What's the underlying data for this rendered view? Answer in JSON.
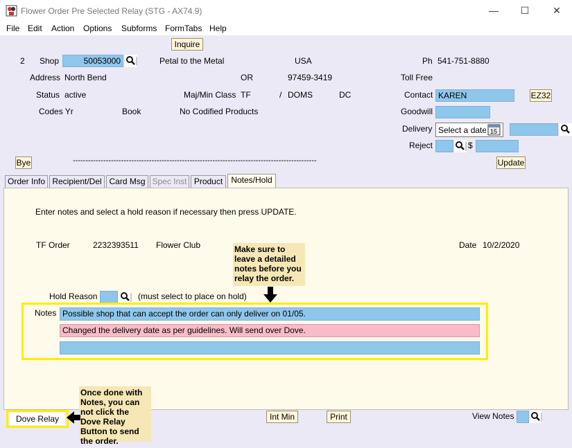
{
  "window": {
    "title": "Flower Order Pre Selected Relay (STG - AX74.9)",
    "minimize": "—",
    "maximize": "☐",
    "close": "✕"
  },
  "menu": [
    "File",
    "Edit",
    "Action",
    "Options",
    "Subforms",
    "FormTabs",
    "Help"
  ],
  "header": {
    "inquire": "Inquire",
    "row_num": "2",
    "shop_label": "Shop",
    "shop_value": "50053000",
    "shop_name": "Petal to the Metal",
    "country": "USA",
    "ph_label": "Ph",
    "phone": "541-751-8880",
    "address_label": "Address",
    "address": "North Bend",
    "state": "OR",
    "zip": "97459-3419",
    "tollfree_label": "Toll Free",
    "status_label": "Status",
    "status": "active",
    "majmin_label": "Maj/Min Class",
    "maj": "TF",
    "slash": "/",
    "min": "DOMS",
    "dc": "DC",
    "contact_label": "Contact",
    "contact": "KAREN",
    "ez_button": "EZ32",
    "codes_label": "Codes Yr",
    "book_label": "Book",
    "codified": "No Codified Products",
    "goodwill_label": "Goodwill",
    "delivery_label": "Delivery",
    "delivery_placeholder": "Select a date",
    "calendar_day": "15",
    "reject_label": "Reject",
    "dollar": "$",
    "bye": "Bye",
    "dashes": "------------------------------------------------------------------------------------------------",
    "update": "Update"
  },
  "tabs": [
    {
      "label": "Order Info",
      "state": "normal"
    },
    {
      "label": "Recipient/Del",
      "state": "normal"
    },
    {
      "label": "Card Msg",
      "state": "normal"
    },
    {
      "label": "Spec Inst",
      "state": "disabled"
    },
    {
      "label": "Product",
      "state": "normal"
    },
    {
      "label": "Notes/Hold",
      "state": "active"
    }
  ],
  "content": {
    "instructions": "Enter notes and select a hold reason if necessary then press UPDATE.",
    "order_label": "TF Order",
    "order_number": "2232393511",
    "order_shop": "Flower Club",
    "date_label": "Date",
    "date": "10/2/2020",
    "hold_label": "Hold Reason",
    "hold_hint": "(must select to place on hold)",
    "notes_label": "Notes",
    "notes": [
      "Possible shop that can accept  the order can only deliver on 01/05.",
      "Changed the delivery date as per guidelines. Will send over Dove.",
      ""
    ]
  },
  "callouts": {
    "top": "Make sure to leave a detailed notes before you relay the order.",
    "bottom": "Once done with Notes, you can not click the Dove Relay Button to send the order."
  },
  "footer": {
    "dove_relay": "Dove Relay",
    "int_min": "Int Min",
    "print": "Print",
    "view_notes": "View Notes"
  },
  "colors": {
    "field_blue": "#8fc6ec",
    "note_pink": "#f8bcc8",
    "highlight_yellow": "#ffee00",
    "callout": "#f6e7b6",
    "panel": "#ece9f6",
    "content_bg": "#fffbea"
  }
}
